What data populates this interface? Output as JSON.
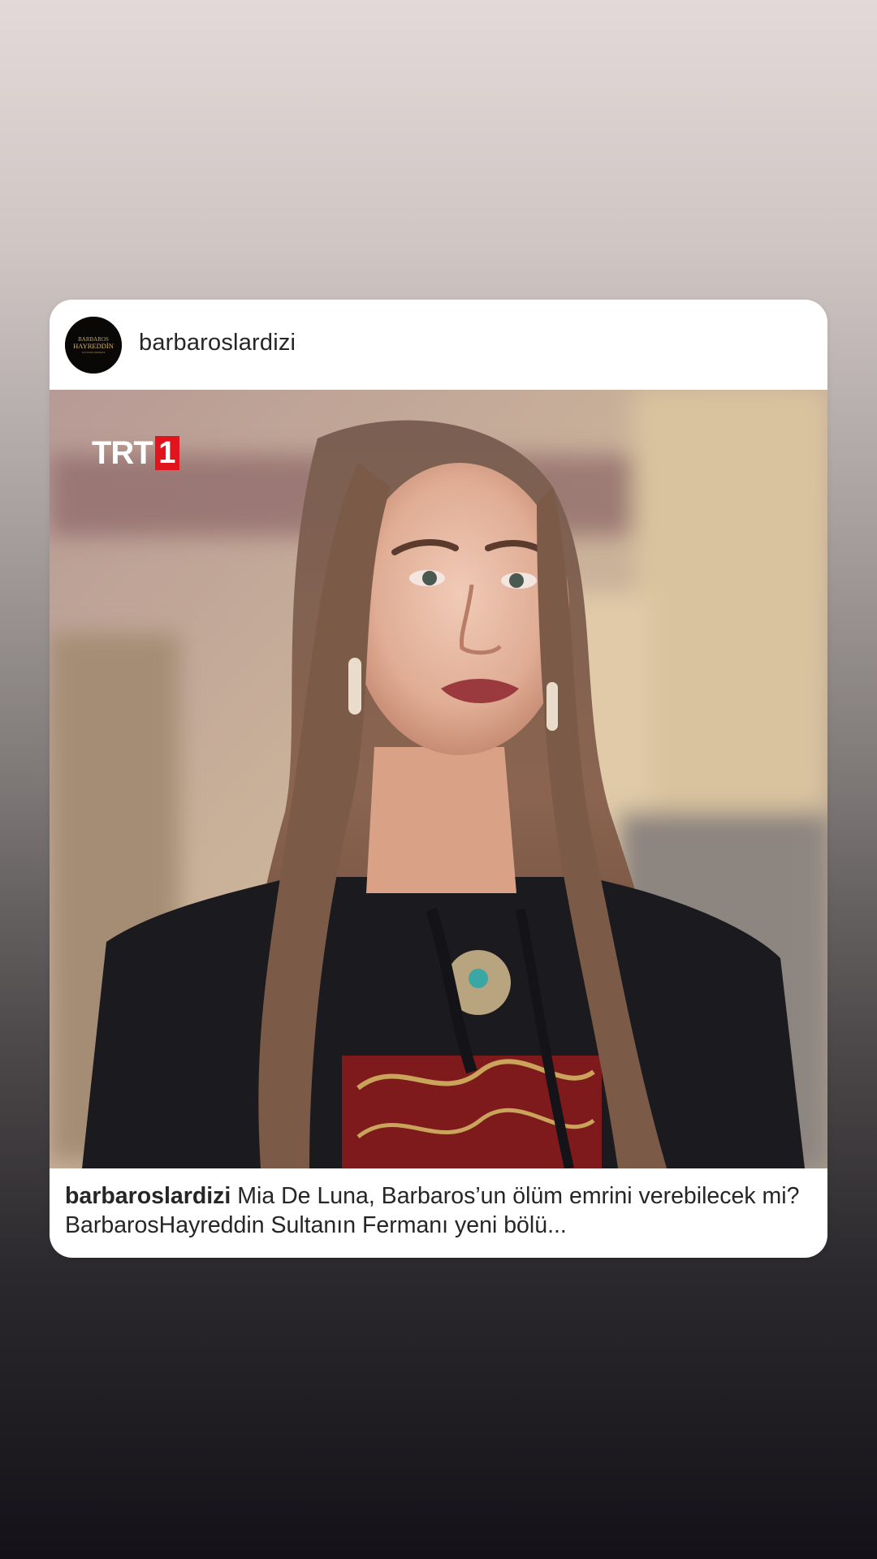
{
  "post": {
    "username": "barbaroslardizi",
    "avatar_icon": "show-logo-icon",
    "avatar_logo_text": [
      "BARBAROS",
      "HAYREDDİN",
      "SULTANIN FERMANI"
    ],
    "watermark": {
      "text": "TRT",
      "number": "1",
      "accent_color": "#e1141d"
    },
    "caption": {
      "username": "barbaroslardizi",
      "text": "Mia De Luna, Barbaros’un ölüm emrini verebilecek mi? BarbarosHayreddin Sultanın Fermanı yeni bölü..."
    }
  }
}
